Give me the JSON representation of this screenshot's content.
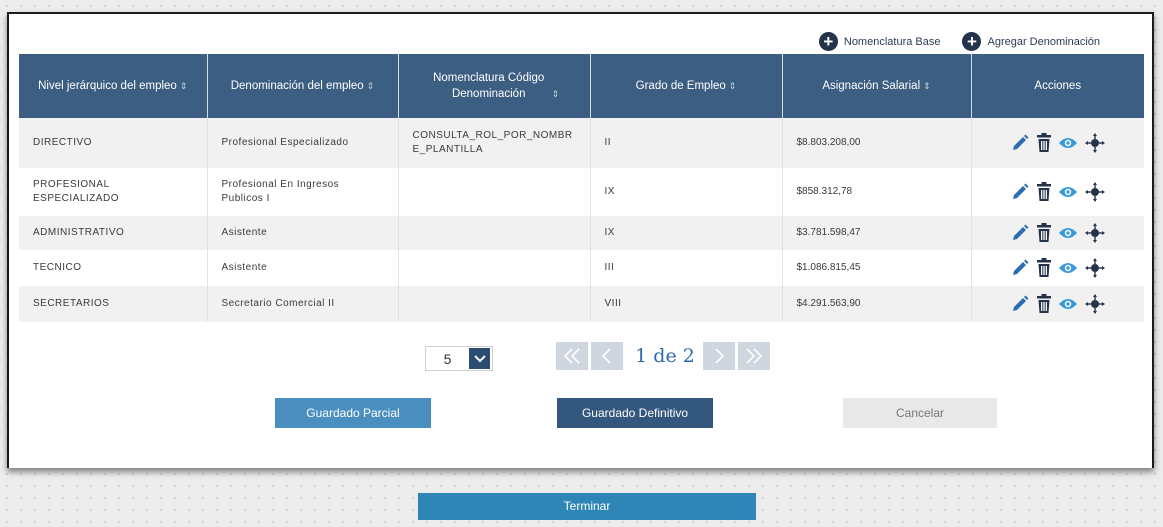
{
  "links": {
    "nomenclatura_base": "Nomenclatura Base",
    "agregar_denominacion": "Agregar Denominación"
  },
  "table": {
    "headers": [
      "Nivel jerárquico del empleo",
      "Denominación del empleo",
      "Nomenclatura Código Denominación",
      "Grado de Empleo",
      "Asignación Salarial",
      "Acciones"
    ],
    "rows": [
      {
        "nivel": "DIRECTIVO",
        "denominacion": "Profesional Especializado",
        "nomenclatura": "CONSULTA_ROL_POR_NOMBRE_PLANTILLA",
        "grado": "II",
        "asignacion": "$8.803.208,00"
      },
      {
        "nivel": "PROFESIONAL ESPECIALIZADO",
        "denominacion": "Profesional En Ingresos Publicos I",
        "nomenclatura": "",
        "grado": "IX",
        "asignacion": "$858.312,78"
      },
      {
        "nivel": "ADMINISTRATIVO",
        "denominacion": "Asistente",
        "nomenclatura": "",
        "grado": "IX",
        "asignacion": "$3.781.598,47"
      },
      {
        "nivel": "TECNICO",
        "denominacion": "Asistente",
        "nomenclatura": "",
        "grado": "III",
        "asignacion": "$1.086.815,45"
      },
      {
        "nivel": "SECRETARIOS",
        "denominacion": "Secretario Comercial II",
        "nomenclatura": "",
        "grado": "VIII",
        "asignacion": "$4.291.563,90"
      }
    ]
  },
  "pagination": {
    "page_size": "5",
    "page_info": "1 de 2"
  },
  "buttons": {
    "parcial": "Guardado Parcial",
    "definitivo": "Guardado Definitivo",
    "cancelar": "Cancelar",
    "terminar": "Terminar"
  },
  "icons": [
    "plus-circle-icon",
    "pencil-icon",
    "trash-icon",
    "eye-icon",
    "move-icon",
    "chevron-down-icon",
    "first-page-icon",
    "prev-page-icon",
    "next-page-icon",
    "last-page-icon"
  ],
  "colors": {
    "header_bg": "#3b5e82",
    "accent_dark": "#24324a",
    "edit_icon": "#2b6db0",
    "view_icon": "#3a9ad9",
    "pager_link": "#2f6aa8"
  }
}
